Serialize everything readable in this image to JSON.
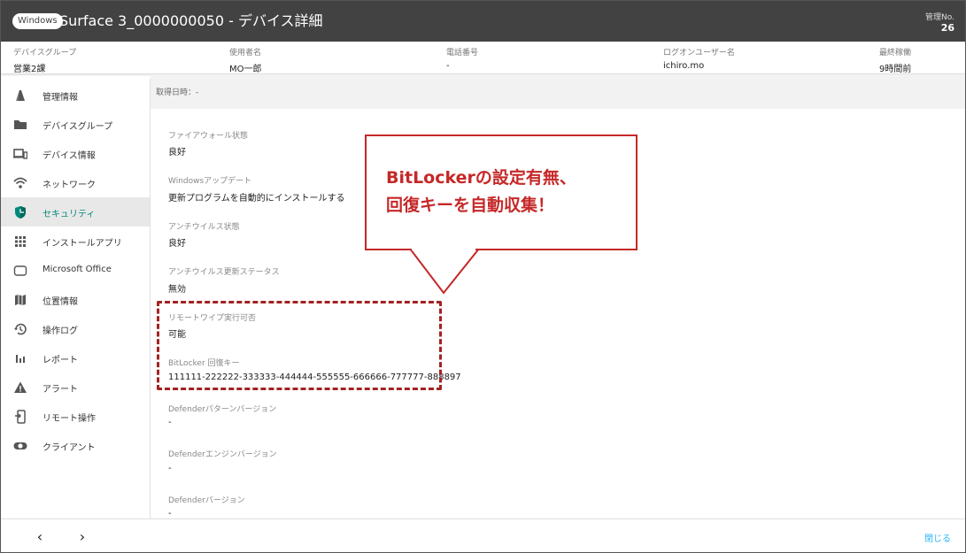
{
  "header": {
    "os_badge": "Windows",
    "title": "Surface 3_0000000050 - デバイス詳細",
    "mgmt_label": "管理No.",
    "mgmt_value": "26"
  },
  "info": [
    {
      "label": "デバイスグループ",
      "value": "営業2課"
    },
    {
      "label": "使用者名",
      "value": "MO一郎"
    },
    {
      "label": "電話番号",
      "value": "-"
    },
    {
      "label": "ログオンユーザー名",
      "value": "ichiro.mo"
    },
    {
      "label": "最終稼働",
      "value": "9時間前"
    }
  ],
  "sidebar": {
    "active_color": "#00897b",
    "items": [
      {
        "label": "管理情報",
        "icon": "book-icon"
      },
      {
        "label": "デバイスグループ",
        "icon": "folder-icon"
      },
      {
        "label": "デバイス情報",
        "icon": "devices-icon"
      },
      {
        "label": "ネットワーク",
        "icon": "wifi-icon"
      },
      {
        "label": "セキュリティ",
        "icon": "shield-icon",
        "active": true
      },
      {
        "label": "インストールアプリ",
        "icon": "apps-grid-icon"
      },
      {
        "label": "Microsoft Office",
        "icon": "office-icon"
      },
      {
        "label": "位置情報",
        "icon": "map-icon"
      },
      {
        "label": "操作ログ",
        "icon": "history-icon"
      },
      {
        "label": "レポート",
        "icon": "bar-chart-icon"
      },
      {
        "label": "アラート",
        "icon": "warning-icon"
      },
      {
        "label": "リモート操作",
        "icon": "remote-device-icon"
      },
      {
        "label": "クライアント",
        "icon": "toggle-icon"
      }
    ]
  },
  "content": {
    "acquired": "取得日時：-",
    "fields": [
      {
        "label": "ファイアウォール状態",
        "value": "良好"
      },
      {
        "label": "Windowsアップデート",
        "value": "更新プログラムを自動的にインストールする"
      },
      {
        "label": "アンチウイルス状態",
        "value": "良好"
      },
      {
        "label": "アンチウイルス更新ステータス",
        "value": "無効"
      },
      {
        "label": "リモートワイプ実行可否",
        "value": "可能"
      },
      {
        "label": "BitLocker 回復キー",
        "value": "111111-222222-333333-444444-555555-666666-777777-888897"
      },
      {
        "label": "Defenderパターンバージョン",
        "value": "-"
      },
      {
        "label": "Defenderエンジンバージョン",
        "value": "-"
      },
      {
        "label": "Defenderバージョン",
        "value": "-"
      }
    ]
  },
  "callout": {
    "line1": "BitLockerの設定有無、",
    "line2": "回復キーを自動収集！",
    "color": "#c62828"
  },
  "footer": {
    "prev": "‹",
    "next": "›",
    "close": "閉じる"
  }
}
